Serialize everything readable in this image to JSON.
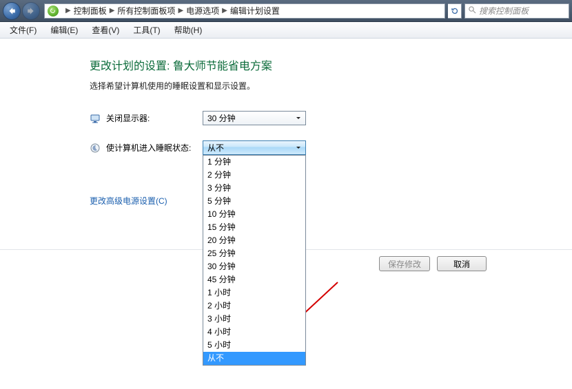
{
  "breadcrumb": {
    "items": [
      "控制面板",
      "所有控制面板项",
      "电源选项",
      "编辑计划设置"
    ]
  },
  "search": {
    "placeholder": "搜索控制面板"
  },
  "menu": {
    "file": "文件(F)",
    "edit": "编辑(E)",
    "view": "查看(V)",
    "tools": "工具(T)",
    "help": "帮助(H)"
  },
  "page": {
    "title": "更改计划的设置: 鲁大师节能省电方案",
    "desc": "选择希望计算机使用的睡眠设置和显示设置。"
  },
  "settings": {
    "display_off_label": "关闭显示器:",
    "display_off_value": "30 分钟",
    "sleep_label": "使计算机进入睡眠状态:",
    "sleep_value": "从不",
    "sleep_options": [
      "1 分钟",
      "2 分钟",
      "3 分钟",
      "5 分钟",
      "10 分钟",
      "15 分钟",
      "20 分钟",
      "25 分钟",
      "30 分钟",
      "45 分钟",
      "1 小时",
      "2 小时",
      "3 小时",
      "4 小时",
      "5 小时",
      "从不"
    ],
    "sleep_selected_index": 15
  },
  "links": {
    "advanced": "更改高级电源设置(C)"
  },
  "buttons": {
    "save": "保存修改",
    "cancel": "取消"
  }
}
